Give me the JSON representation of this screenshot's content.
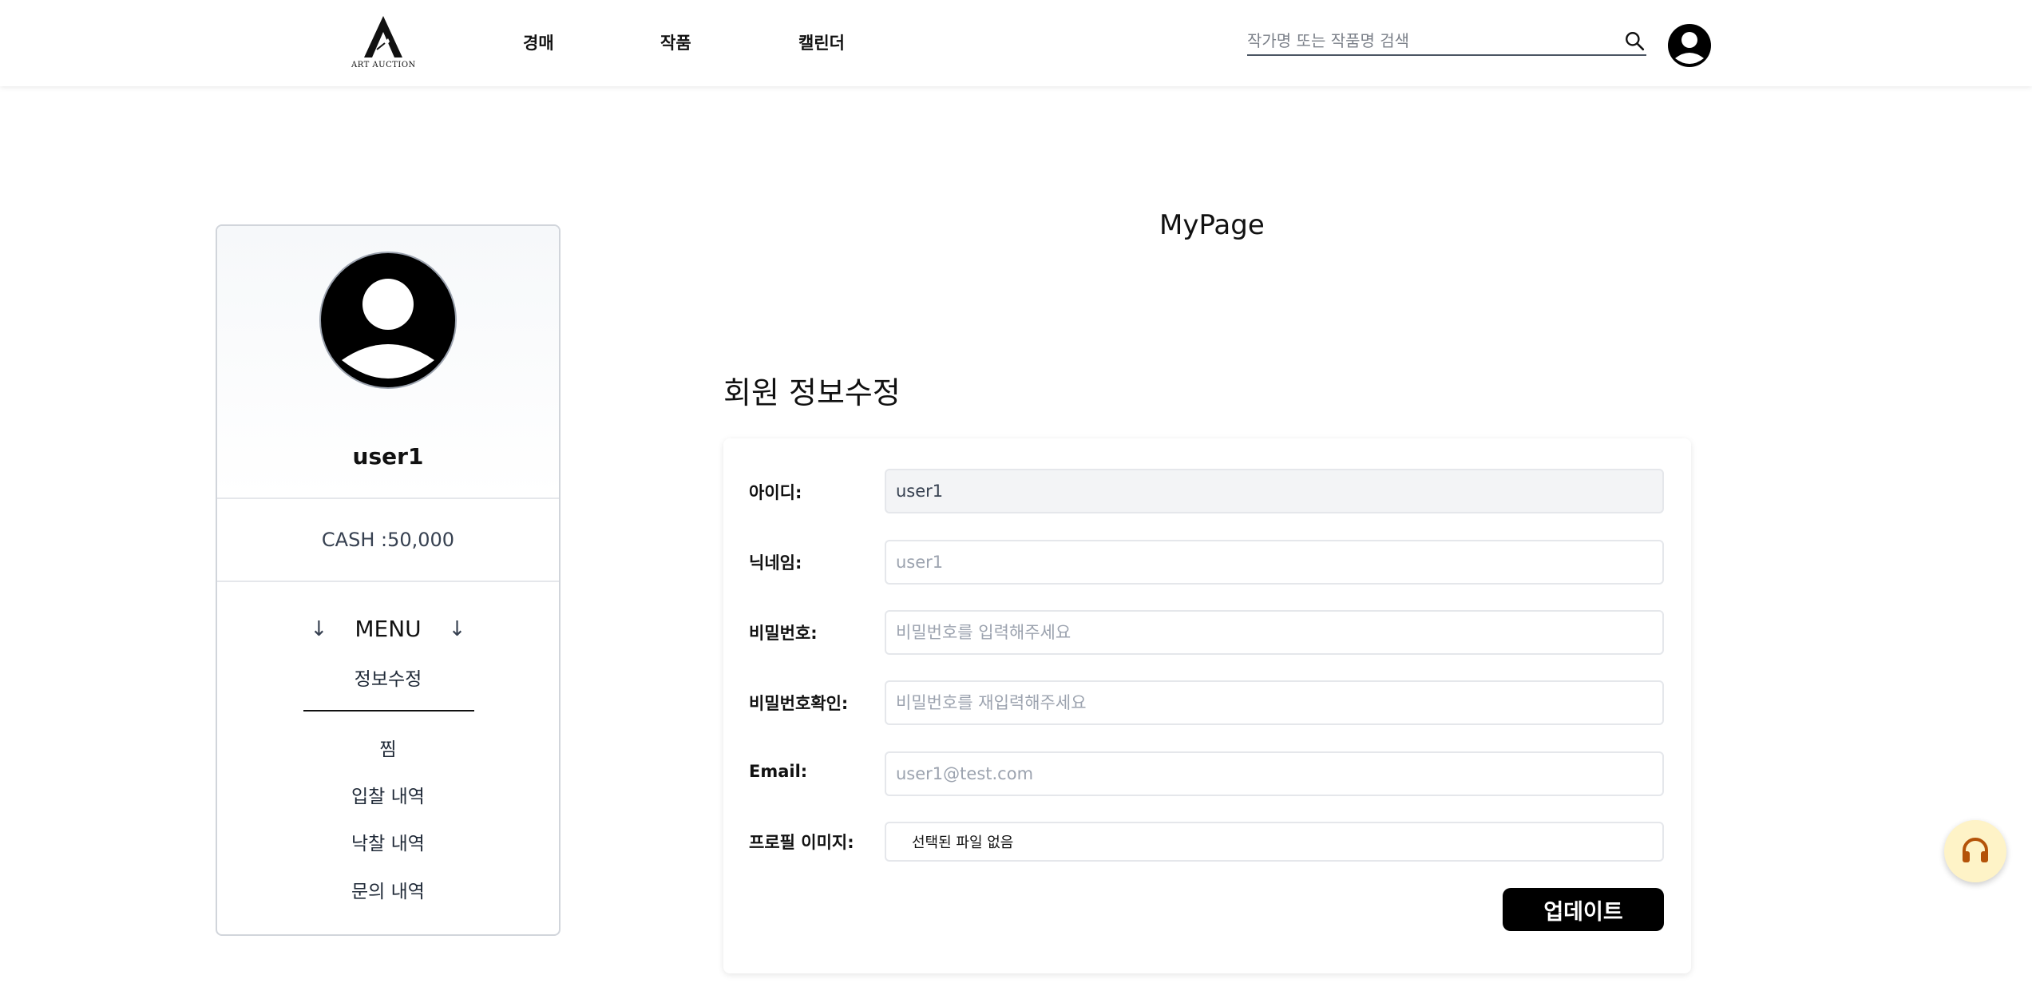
{
  "header": {
    "logo_text": "ART AUCTION",
    "nav": [
      {
        "label": "경매"
      },
      {
        "label": "작품"
      },
      {
        "label": "캘린더"
      }
    ],
    "search": {
      "placeholder": "작가명 또는 작품명 검색",
      "value": ""
    }
  },
  "sidebar": {
    "username": "user1",
    "cash": "CASH :50,000",
    "menu_title": "MENU",
    "menu_items": [
      {
        "label": "정보수정",
        "active": true
      },
      {
        "label": "찜"
      },
      {
        "label": "입찰 내역"
      },
      {
        "label": "낙찰 내역"
      },
      {
        "label": "문의 내역"
      }
    ]
  },
  "main": {
    "page_title": "MyPage",
    "section_title": "회원 정보수정",
    "form": {
      "id": {
        "label": "아이디:",
        "value": "user1"
      },
      "nickname": {
        "label": "닉네임:",
        "placeholder": "user1"
      },
      "password": {
        "label": "비밀번호:",
        "placeholder": "비밀번호를 입력해주세요"
      },
      "password_confirm": {
        "label": "비밀번호확인:",
        "placeholder": "비밀번호를 재입력해주세요"
      },
      "email": {
        "label": "Email:",
        "placeholder": "user1@test.com"
      },
      "profile_image": {
        "label": "프로필 이미지:",
        "file_status": "선택된 파일 없음"
      },
      "submit_label": "업데이트"
    }
  },
  "colors": {
    "accent": "#000000",
    "support_button_bg": "#fef3c7",
    "support_icon": "#b45309"
  },
  "icons": {
    "search": "search-icon",
    "user": "user-avatar-icon",
    "support": "headset-icon",
    "arrow": "arrow-down-icon"
  }
}
